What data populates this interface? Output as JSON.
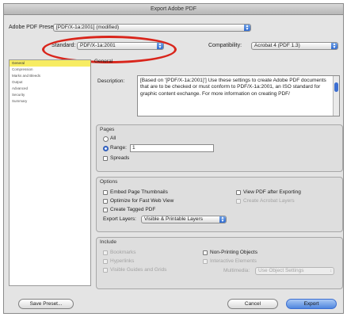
{
  "window": {
    "title": "Export Adobe PDF"
  },
  "preset": {
    "label": "Adobe PDF Preset:",
    "value": "[PDF/X-1a:2001] (modified)"
  },
  "standard": {
    "label": "Standard:",
    "value": "PDF/X-1a:2001"
  },
  "compatibility": {
    "label": "Compatibility:",
    "value": "Acrobat 4 (PDF 1.3)"
  },
  "sidebar": {
    "items": [
      {
        "label": "General",
        "selected": true
      },
      {
        "label": "Compression",
        "selected": false
      },
      {
        "label": "Marks and Bleeds",
        "selected": false
      },
      {
        "label": "Output",
        "selected": false
      },
      {
        "label": "Advanced",
        "selected": false
      },
      {
        "label": "Security",
        "selected": false
      },
      {
        "label": "Summary",
        "selected": false
      }
    ]
  },
  "general": {
    "heading": "General",
    "description_label": "Description:",
    "description": "[Based on '[PDF/X-1a:2001]'] Use these settings to create Adobe PDF documents that are to be checked or must conform to PDF/X-1a:2001, an ISO standard for graphic content exchange.  For more information on creating PDF/"
  },
  "pages": {
    "title": "Pages",
    "all_label": "All",
    "range_label": "Range:",
    "range_value": "1",
    "spreads_label": "Spreads"
  },
  "options": {
    "title": "Options",
    "embed_thumbnails": "Embed Page Thumbnails",
    "optimize_web": "Optimize for Fast Web View",
    "create_tagged": "Create Tagged PDF",
    "view_after": "View PDF after Exporting",
    "create_layers": "Create Acrobat Layers",
    "export_layers_label": "Export Layers:",
    "export_layers_value": "Visible & Printable Layers"
  },
  "include": {
    "title": "Include",
    "bookmarks": "Bookmarks",
    "hyperlinks": "Hyperlinks",
    "visible_guides": "Visible Guides and Grids",
    "non_printing": "Non-Printing Objects",
    "interactive": "Interactive Elements",
    "multimedia_label": "Multimedia:",
    "multimedia_value": "Use Object Settings"
  },
  "buttons": {
    "save_preset": "Save Preset...",
    "cancel": "Cancel",
    "export": "Export"
  },
  "colors": {
    "accent": "#3d6fd1",
    "selection": "#f7ec62",
    "annotation": "#d9251b"
  }
}
